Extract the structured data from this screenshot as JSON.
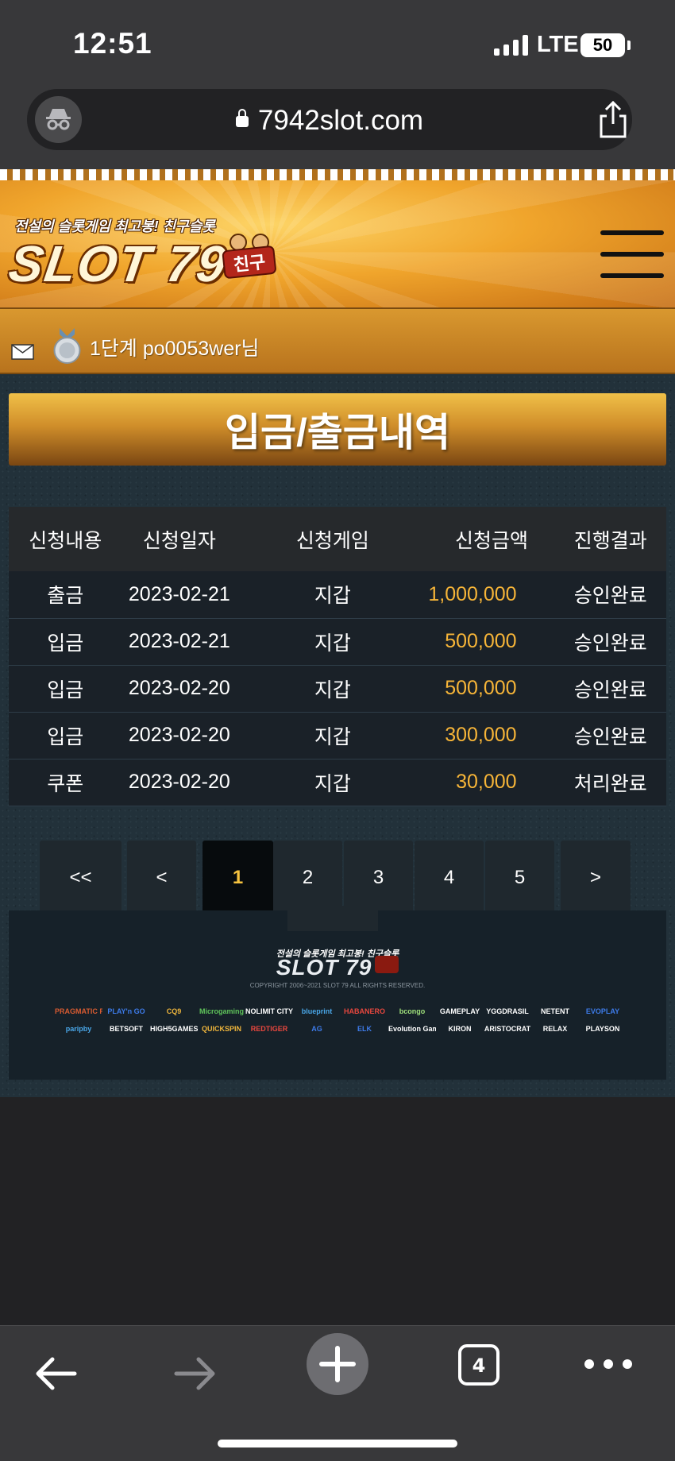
{
  "status_bar": {
    "time": "12:51",
    "network": "LTE",
    "battery": "50"
  },
  "browser": {
    "url": "7942slot.com"
  },
  "site": {
    "logo_tagline": "전설의 슬롯게임 최고봉! 친구슬롯",
    "logo_text": "SLOT 79",
    "logo_badge": "친구"
  },
  "user": {
    "label": "1단계 po0053wer님"
  },
  "page": {
    "title": "입금/출금내역"
  },
  "table": {
    "headers": [
      "신청내용",
      "신청일자",
      "신청게임",
      "신청금액",
      "진행결과"
    ],
    "rows": [
      {
        "type": "출금",
        "date": "2023-02-21",
        "game": "지갑",
        "amount": "1,000,000",
        "result": "승인완료"
      },
      {
        "type": "입금",
        "date": "2023-02-21",
        "game": "지갑",
        "amount": "500,000",
        "result": "승인완료"
      },
      {
        "type": "입금",
        "date": "2023-02-20",
        "game": "지갑",
        "amount": "500,000",
        "result": "승인완료"
      },
      {
        "type": "입금",
        "date": "2023-02-20",
        "game": "지갑",
        "amount": "300,000",
        "result": "승인완료"
      },
      {
        "type": "쿠폰",
        "date": "2023-02-20",
        "game": "지갑",
        "amount": "30,000",
        "result": "처리완료"
      }
    ]
  },
  "pagination": {
    "first": "<<",
    "prev": "<",
    "pages": [
      "1",
      "2",
      "3",
      "4",
      "5"
    ],
    "current": "1",
    "next": ">"
  },
  "footer": {
    "tagline": "전설의 슬롯게임 최고봉! 친구슬롯",
    "logo": "SLOT 79",
    "copyright": "COPYRIGHT 2006~2021 SLOT 79 ALL RIGHTS RESERVED.",
    "providers": [
      "PRAGMATIC PLAY",
      "PLAY'n GO",
      "CQ9",
      "Microgaming",
      "NOLIMIT CITY",
      "blueprint",
      "HABANERO",
      "bcongo",
      "GAMEPLAY",
      "YGGDRASIL",
      "NETENT",
      "EVOPLAY",
      "paripby",
      "BETSOFT",
      "HIGH5GAMES",
      "QUICKSPIN",
      "REDTIGER",
      "AG",
      "ELK",
      "Evolution Gaming",
      "KIRON",
      "ARISTOCRAT",
      "RELAX",
      "PLAYSON"
    ]
  },
  "toolbar": {
    "tab_count": "4"
  },
  "colors": {
    "accent": "#f7b538",
    "header_gold": "#f0a52c",
    "active_page": "#f6c33f"
  }
}
